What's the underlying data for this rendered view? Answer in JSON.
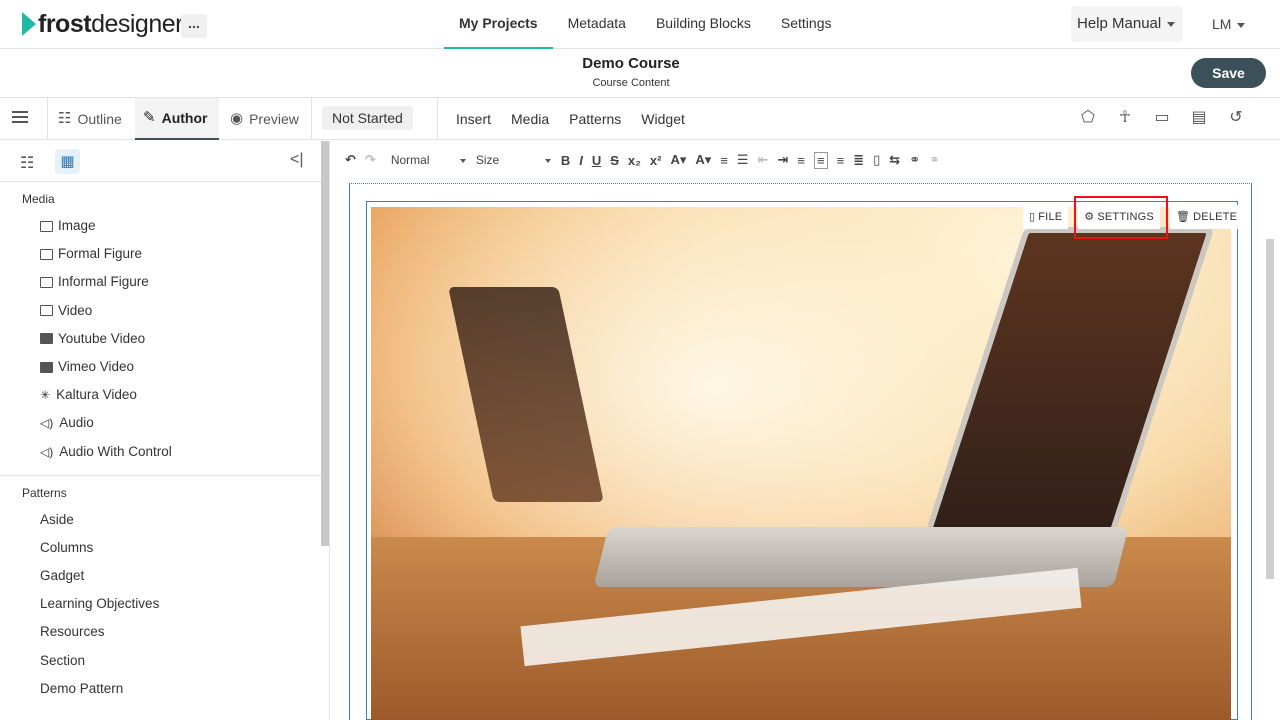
{
  "header": {
    "logo_bold": "frost",
    "logo_light": "designer",
    "more_label": "...",
    "nav": [
      "My Projects",
      "Metadata",
      "Building Blocks",
      "Settings"
    ],
    "help_label": "Help Manual",
    "user_label": "LM"
  },
  "course": {
    "title": "Demo Course",
    "subtitle": "Course Content",
    "save_label": "Save"
  },
  "modes": {
    "outline": "Outline",
    "author": "Author",
    "preview": "Preview",
    "status": "Not Started",
    "menu": [
      "Insert",
      "Media",
      "Patterns",
      "Widget"
    ],
    "icons": [
      "tag-icon",
      "accessibility-icon",
      "comment-icon",
      "card-icon",
      "history-icon"
    ]
  },
  "toolbar": {
    "paragraph": "Normal",
    "size": "Size"
  },
  "leftpanel": {
    "media_heading": "Media",
    "media_items": [
      "Image",
      "Formal Figure",
      "Informal Figure",
      "Video",
      "Youtube Video",
      "Vimeo Video",
      "Kaltura Video",
      "Audio",
      "Audio With Control"
    ],
    "patterns_heading": "Patterns",
    "pattern_items": [
      "Aside",
      "Columns",
      "Gadget",
      "Learning Objectives",
      "Resources",
      "Section",
      "Demo Pattern"
    ]
  },
  "image_actions": {
    "file": "FILE",
    "settings": "SETTINGS",
    "delete": "DELETE"
  },
  "colors": {
    "accent": "#1fb8a2",
    "save_bg": "#3b5058",
    "highlight": "#ee1111"
  }
}
